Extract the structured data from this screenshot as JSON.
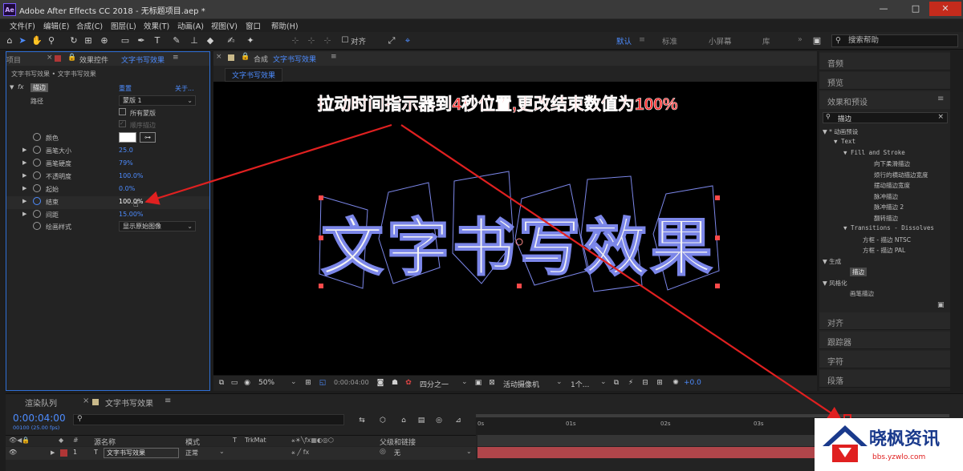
{
  "window": {
    "app_icon": "Ae",
    "title": "Adobe After Effects CC 2018 - 无标题项目.aep *",
    "buttons": [
      "—",
      "□",
      "✕"
    ]
  },
  "menu": [
    "文件(F)",
    "编辑(E)",
    "合成(C)",
    "图层(L)",
    "效果(T)",
    "动画(A)",
    "视图(V)",
    "窗口",
    "帮助(H)"
  ],
  "toolbar": {
    "snap_label": "对齐",
    "workspaces": [
      "默认",
      "标准",
      "小屏幕",
      "库"
    ],
    "search_placeholder": "搜索帮助"
  },
  "effect_controls": {
    "tab_project": "项目",
    "tab_label": "效果控件",
    "tab_layer": "文字书写效果",
    "breadcrumb": "文字书写效果 • 文字书写效果",
    "effect_name": "描边",
    "reset": "重置",
    "about": "关于...",
    "path_label": "路径",
    "path_value": "蒙版 1",
    "all_masks": "所有蒙版",
    "sequential": "顺序描边",
    "props": [
      {
        "label": "颜色",
        "value": ""
      },
      {
        "label": "画笔大小",
        "value": "25.0"
      },
      {
        "label": "画笔硬度",
        "value": "79%"
      },
      {
        "label": "不透明度",
        "value": "100.0%"
      },
      {
        "label": "起始",
        "value": "0.0%"
      },
      {
        "label": "结束",
        "value": "100.0%"
      },
      {
        "label": "间距",
        "value": "15.00%"
      }
    ],
    "paint_style_label": "绘画样式",
    "paint_style_value": "显示原始图像"
  },
  "composition": {
    "tab_label": "合成",
    "tab_name": "文字书写效果",
    "sub_tab": "文字书写效果",
    "annotation": "拉动时间指示器到4秒位置,更改结束数值为100%",
    "canvas_text": "文字书写效果",
    "zoom": "50%",
    "timecode": "0:00:04:00",
    "resolution": "四分之一",
    "camera": "活动摄像机",
    "views": "1个...",
    "exposure": "+0.0"
  },
  "right_panel": {
    "sections_top": [
      "音频",
      "预览"
    ],
    "effects_title": "效果和预设",
    "search_value": "描边",
    "tree": [
      "▼ * 动画预设",
      "▼ Text",
      "▼ Fill and Stroke",
      "向下柔滑描边",
      "烦行的横动描边宽度",
      "摆动描边宽度",
      "脉冲描边",
      "脉冲描边 2",
      "翻转描边",
      "▼ Transitions - Dissolves",
      "方框 - 描边 NTSC",
      "方框 - 描边 PAL",
      "▼ 生成",
      "描边",
      "▼ 风格化",
      "画笔描边"
    ],
    "sections_bottom": [
      "对齐",
      "跟踪器",
      "字符",
      "段落"
    ]
  },
  "timeline": {
    "tab_render": "渲染队列",
    "tab_comp": "文字书写效果",
    "timecode": "0:00:04:00",
    "fps": "00100 (25.00 fps)",
    "ruler": [
      "0s",
      "01s",
      "02s",
      "03s",
      "04s",
      "05s"
    ],
    "columns": {
      "name": "源名称",
      "mode": "模式",
      "t": "T",
      "trkmat": "TrkMat",
      "parent": "父级和链接"
    },
    "layer": {
      "number": "1",
      "name": "文字书写效果",
      "mode": "正常",
      "parent": "无"
    }
  },
  "watermark": {
    "brand": "晓枫资讯",
    "url": "bbs.yzwlo.com"
  },
  "colors": {
    "accent": "#2f6fd6",
    "annotation": "#e02020",
    "layer_bar": "#b0454a",
    "value_blue": "#4d8cff"
  }
}
